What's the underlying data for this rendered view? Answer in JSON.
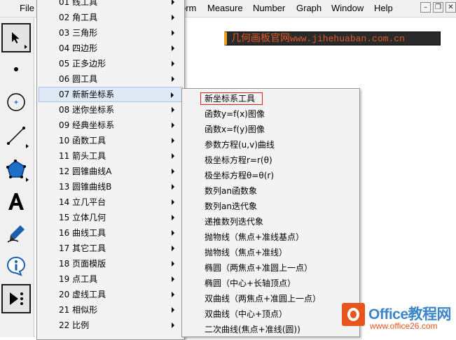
{
  "menubar": {
    "items": [
      "File",
      "Transform",
      "Measure",
      "Number",
      "Graph",
      "Window",
      "Help"
    ],
    "visible_first": "File",
    "visible_partial": "orm"
  },
  "window_buttons": {
    "minimize": "–",
    "restore": "❐",
    "close": "✕"
  },
  "watermark": {
    "cn": "几何画板官网",
    "url": "www.jihehuaban.com.cn"
  },
  "menu_tools": {
    "items": [
      {
        "label": "01 线工具"
      },
      {
        "label": "02 角工具"
      },
      {
        "label": "03 三角形"
      },
      {
        "label": "04 四边形"
      },
      {
        "label": "05 正多边形"
      },
      {
        "label": "06 圆工具"
      },
      {
        "label": "07 新新坐标系"
      },
      {
        "label": "08 迷你坐标系"
      },
      {
        "label": "09 经典坐标系"
      },
      {
        "label": "10 函数工具"
      },
      {
        "label": "11 箭头工具"
      },
      {
        "label": "12 圆锥曲线A"
      },
      {
        "label": "13 圆锥曲线B"
      },
      {
        "label": "14 立几平台"
      },
      {
        "label": "15 立体几何"
      },
      {
        "label": "16 曲线工具"
      },
      {
        "label": "17 其它工具"
      },
      {
        "label": "18 页面模版"
      },
      {
        "label": "19 点工具"
      },
      {
        "label": "20 虚线工具"
      },
      {
        "label": "21 相似形"
      },
      {
        "label": "22 比例"
      }
    ],
    "highlighted_index": 6
  },
  "menu_coords": {
    "items": [
      {
        "label": "新坐标系工具"
      },
      {
        "label": "函数y=f(x)图像"
      },
      {
        "label": "函数x=f(y)图像"
      },
      {
        "label": "参数方程(u,v)曲线"
      },
      {
        "label": "极坐标方程r=r(θ)"
      },
      {
        "label": "极坐标方程θ=θ(r)"
      },
      {
        "label": "数列an函数象"
      },
      {
        "label": "数列an迭代象"
      },
      {
        "label": "递推数列迭代象"
      },
      {
        "label": "抛物线（焦点+准线基点）"
      },
      {
        "label": "抛物线（焦点+准线）"
      },
      {
        "label": "椭圆（两焦点+准圆上一点）"
      },
      {
        "label": "椭圆（中心+长轴顶点）"
      },
      {
        "label": "双曲线（两焦点+准圆上一点）"
      },
      {
        "label": "双曲线（中心+顶点）"
      },
      {
        "label": "二次曲线(焦点+准线(圆))"
      }
    ],
    "highlighted_index": 0
  },
  "tools": [
    {
      "name": "selection-arrow-tool-icon"
    },
    {
      "name": "point-tool-icon"
    },
    {
      "name": "compass-tool-icon"
    },
    {
      "name": "straightedge-tool-icon"
    },
    {
      "name": "polygon-tool-icon"
    },
    {
      "name": "text-tool-icon"
    },
    {
      "name": "marker-tool-icon"
    },
    {
      "name": "information-tool-icon"
    },
    {
      "name": "custom-tools-icon"
    }
  ],
  "logo": {
    "name": "Office教程网",
    "site": "www.office26.com"
  },
  "colors": {
    "accent": "#3a86c8",
    "logo_orange": "#e8541c",
    "highlight_box": "#e02020",
    "menu_hover": "#dfe9f6"
  }
}
